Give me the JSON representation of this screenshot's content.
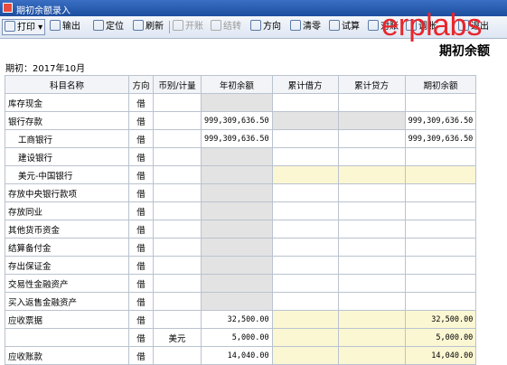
{
  "window": {
    "title": "期初余额录入"
  },
  "toolbar": {
    "print": "打印",
    "output": "输出",
    "locate": "定位",
    "refresh": "刷新",
    "open_account": "开账",
    "transfer": "结转",
    "direction": "方向",
    "clear": "清零",
    "trial": "试算",
    "check": "对账",
    "reconcile": "调账",
    "exit": "退出"
  },
  "watermark": "erplabs",
  "page": {
    "heading": "期初余额",
    "period": "期初：2017年10月"
  },
  "table": {
    "headers": [
      "科目名称",
      "方向",
      "币别/计量",
      "年初余额",
      "累计借方",
      "累计贷方",
      "期初余额"
    ],
    "rows": [
      {
        "name": "库存现金",
        "dir": "借",
        "cur": "",
        "year": "",
        "debit": "",
        "credit": "",
        "open": ""
      },
      {
        "name": "银行存款",
        "dir": "借",
        "cur": "",
        "year": "999,309,636.50",
        "debit": "",
        "credit": "",
        "open": "999,309,636.50"
      },
      {
        "name": "工商银行",
        "dir": "借",
        "cur": "",
        "year": "999,309,636.50",
        "debit": "",
        "credit": "",
        "open": "999,309,636.50"
      },
      {
        "name": "建设银行",
        "dir": "借",
        "cur": "",
        "year": "",
        "debit": "",
        "credit": "",
        "open": ""
      },
      {
        "name": "美元-中国银行",
        "dir": "借",
        "cur": "",
        "year": "",
        "debit": "",
        "credit": "",
        "open": ""
      },
      {
        "name": "存放中央银行款项",
        "dir": "借",
        "cur": "",
        "year": "",
        "debit": "",
        "credit": "",
        "open": ""
      },
      {
        "name": "存放同业",
        "dir": "借",
        "cur": "",
        "year": "",
        "debit": "",
        "credit": "",
        "open": ""
      },
      {
        "name": "其他货币资金",
        "dir": "借",
        "cur": "",
        "year": "",
        "debit": "",
        "credit": "",
        "open": ""
      },
      {
        "name": "结算备付金",
        "dir": "借",
        "cur": "",
        "year": "",
        "debit": "",
        "credit": "",
        "open": ""
      },
      {
        "name": "存出保证金",
        "dir": "借",
        "cur": "",
        "year": "",
        "debit": "",
        "credit": "",
        "open": ""
      },
      {
        "name": "交易性金融资产",
        "dir": "借",
        "cur": "",
        "year": "",
        "debit": "",
        "credit": "",
        "open": ""
      },
      {
        "name": "买入返售金融资产",
        "dir": "借",
        "cur": "",
        "year": "",
        "debit": "",
        "credit": "",
        "open": ""
      },
      {
        "name": "应收票据",
        "dir": "借",
        "cur": "",
        "year": "32,500.00",
        "debit": "",
        "credit": "",
        "open": "32,500.00"
      },
      {
        "name": "",
        "dir": "借",
        "cur": "美元",
        "year": "5,000.00",
        "debit": "",
        "credit": "",
        "open": "5,000.00"
      },
      {
        "name": "应收账款",
        "dir": "借",
        "cur": "",
        "year": "14,040.00",
        "debit": "",
        "credit": "",
        "open": "14,040.00"
      }
    ]
  },
  "colors": {
    "titlebar": "#1d4e9e",
    "watermark": "#e8262c",
    "locked_cell": "#e3e3e3",
    "editable_cell": "#fbf7d3"
  }
}
